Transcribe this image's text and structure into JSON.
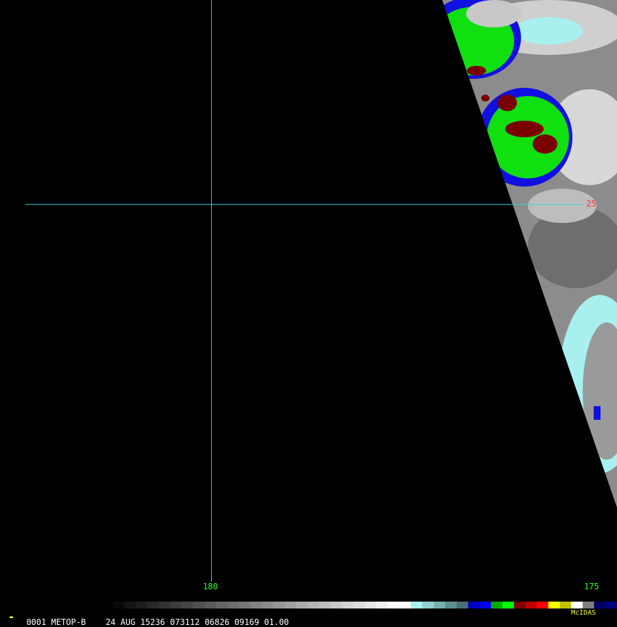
{
  "satellite": "METOP-B",
  "frame_number": "0001",
  "footer_info": "24 AUG 15236 073112 06826 09169 01.00",
  "software": "McIDAS",
  "grid": {
    "latitude_label": "25",
    "longitude_labels": [
      "180",
      "175"
    ]
  },
  "colors": {
    "background": "#000000",
    "grid_line": "#40d0e0",
    "latitude_label": "#ff3030",
    "longitude_label": "#30ff30",
    "text": "#ffffff",
    "software_label": "#ffff40",
    "cloud_gray": "#8c8c8c",
    "cloud_light": "#d8d8d8",
    "cyan_band": "#a8f0f0",
    "blue_band": "#1010e0",
    "green_band": "#10e010",
    "red_core": "#7a0000"
  },
  "color_scale": [
    "#000000",
    "#0a0a0a",
    "#141414",
    "#1e1e1e",
    "#282828",
    "#323232",
    "#3c3c3c",
    "#464646",
    "#505050",
    "#5a5a5a",
    "#646464",
    "#6e6e6e",
    "#787878",
    "#828282",
    "#8c8c8c",
    "#969696",
    "#a0a0a0",
    "#aaaaaa",
    "#b4b4b4",
    "#bebebe",
    "#c8c8c8",
    "#d2d2d2",
    "#dcdcdc",
    "#e6e6e6",
    "#f0f0f0",
    "#ffffff",
    "#ffffff",
    "#a8f0f0",
    "#90d0d0",
    "#78b0b0",
    "#609090",
    "#487070",
    "#0000c0",
    "#0000ff",
    "#00b000",
    "#00ff00",
    "#800000",
    "#c00000",
    "#ff0000",
    "#ffff00",
    "#c0c000",
    "#ffffff",
    "#808080",
    "#000060",
    "#000080"
  ]
}
